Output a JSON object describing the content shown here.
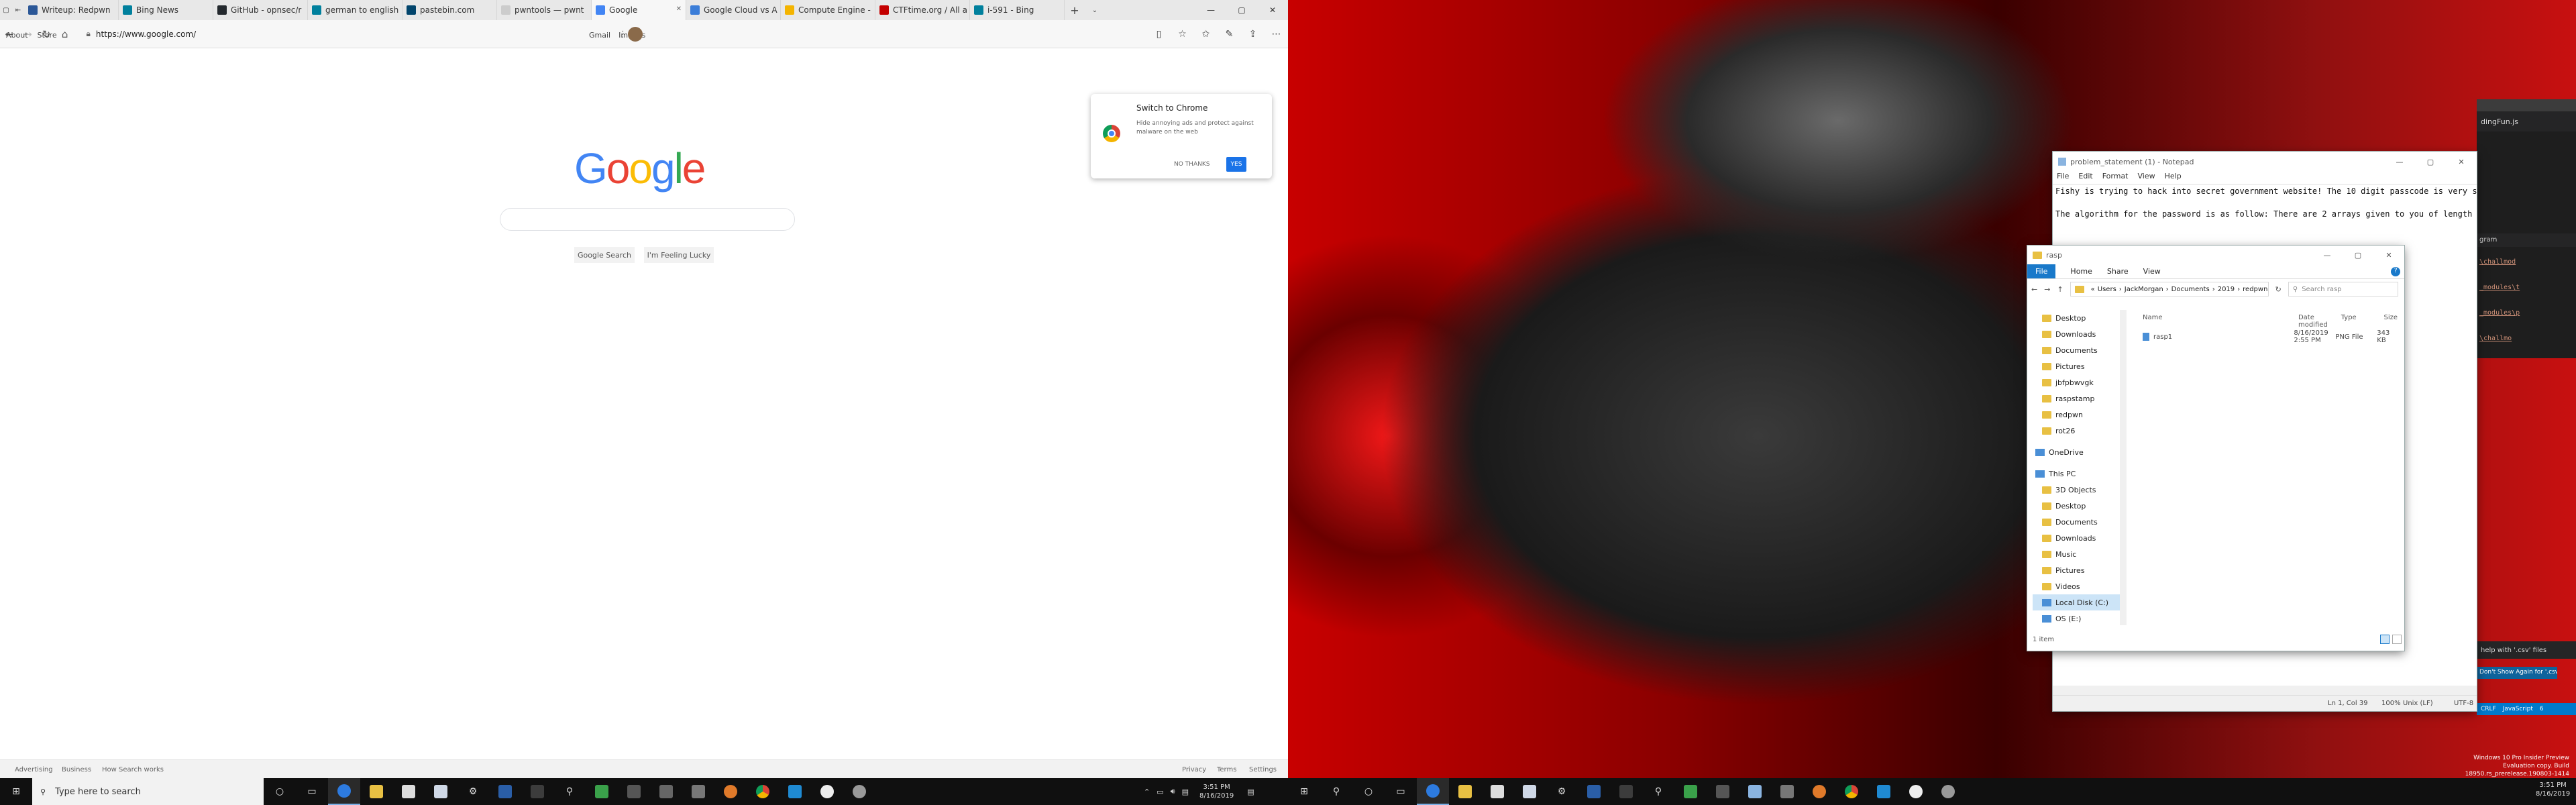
{
  "left": {
    "tabs": [
      {
        "label": "Writeup: Redpwn",
        "color": "#2b5797"
      },
      {
        "label": "Bing News",
        "color": "#00809d"
      },
      {
        "label": "GitHub - opnsec/r",
        "color": "#24292e"
      },
      {
        "label": "german to english",
        "color": "#00809d"
      },
      {
        "label": "pastebin.com",
        "color": "#02456c"
      },
      {
        "label": "pwntools — pwnt",
        "color": "#cccccc"
      },
      {
        "label": "Google",
        "color": "#4285f4"
      },
      {
        "label": "Google Cloud vs A",
        "color": "#3b7dd8"
      },
      {
        "label": "Compute Engine -",
        "color": "#f4b400"
      },
      {
        "label": "CTFtime.org / All a",
        "color": "#c40000"
      },
      {
        "label": "i-591 - Bing",
        "color": "#00809d"
      }
    ],
    "url": "https://www.google.com/",
    "google": {
      "top_left": [
        "About",
        "Store"
      ],
      "top_right": [
        "Gmail",
        "Images"
      ],
      "logo": [
        "G",
        "o",
        "o",
        "g",
        "l",
        "e"
      ],
      "search_button": "Google Search",
      "lucky_button": "I'm Feeling Lucky",
      "promo_title": "Switch to Chrome",
      "promo_body": "Hide annoying ads and protect against malware on the web",
      "promo_no": "NO THANKS",
      "promo_yes": "YES",
      "footer_left": [
        "Advertising",
        "Business",
        "How Search works"
      ],
      "footer_right": [
        "Privacy",
        "Terms",
        "Settings"
      ]
    },
    "taskbar": {
      "search_placeholder": "Type here to search",
      "time": "3:51 PM",
      "date": "8/16/2019"
    }
  },
  "right": {
    "notepad": {
      "title": "problem_statement (1) - Notepad",
      "menu": [
        "File",
        "Edit",
        "Format",
        "View",
        "Help"
      ],
      "line1": "Fishy is trying to hack into secret government website! The 10 digit passcode is very secure, but in order to generate the passcode, a secret algorithm was used. Fishy was abl",
      "line2": "The algorithm for the password is as follow: There are 2 arrays given to you of length n: a and b. For each subsequence of a that can be created by deleting some (maybe all) o",
      "status": [
        "Ln 1, Col 39",
        "100%",
        "Unix (LF)",
        "UTF-8"
      ]
    },
    "explorer": {
      "title": "rasp",
      "ribbon": [
        "File",
        "Home",
        "Share",
        "View"
      ],
      "path": [
        "Users",
        "JackMorgan",
        "Documents",
        "2019",
        "redpwn",
        "raspstamp",
        "rasp"
      ],
      "search_placeholder": "Search rasp",
      "columns": [
        "Name",
        "Date modified",
        "Type",
        "Size"
      ],
      "files": [
        {
          "name": "rasp1",
          "date": "8/16/2019 2:55 PM",
          "type": "PNG File",
          "size": "343 KB"
        }
      ],
      "tree": [
        "Desktop",
        "Downloads",
        "Documents",
        "Pictures",
        "jbfpbwvgk",
        "raspstamp",
        "redpwn",
        "rot26",
        "OneDrive",
        "This PC",
        "3D Objects",
        "Desktop",
        "Documents",
        "Downloads",
        "Music",
        "Pictures",
        "Videos",
        "Local Disk (C:)",
        "OS (E:)"
      ],
      "status": "1 item"
    },
    "vscode": {
      "tab": "dingFun.js",
      "panel_label": "gram",
      "terminal_lines": [
        "\\challmod",
        "_modules\\t",
        "_modules\\p",
        "\\challmo"
      ],
      "notif": "help with '.csv' files",
      "notif_btn": "Don't Show Again for '.csv' files",
      "status": [
        "CRLF",
        "JavaScript",
        "6"
      ]
    },
    "watermark": [
      "Windows 10 Pro Insider Preview",
      "Evaluation copy. Build 18950.rs_prerelease.190803-1414"
    ],
    "time": "3:51 PM",
    "date": "8/16/2019"
  }
}
